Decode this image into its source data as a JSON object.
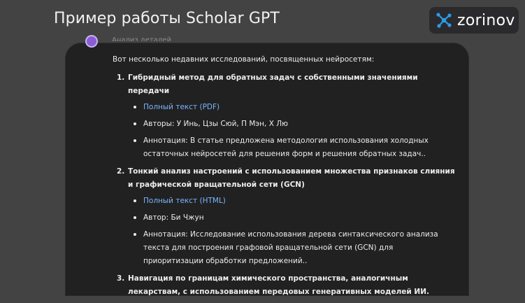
{
  "page": {
    "title": "Пример работы Scholar GPT",
    "brand": "zorinov",
    "brand_color": "#2b9be8"
  },
  "chat": {
    "header_snippet": "Анализ деталей",
    "intro": "Вот несколько недавних исследований, посвященных нейросетям:",
    "papers": [
      {
        "num": "1.",
        "title": "Гибридный метод для обратных задач с собственными значениями передачи",
        "link": "Полный текст (PDF)",
        "authors": "Авторы: У Инь, Цзы Сюй, П Мэн, Х Лю",
        "abstract": "Аннотация: В статье предложена методология использования холодных остаточных нейросетей для решения форм и решения обратных задач.."
      },
      {
        "num": "2.",
        "title": "Тонкий анализ настроений с использованием множества признаков слияния и графической вращательной сети (GCN)",
        "link": "Полный текст (HTML)",
        "authors": "Автор: Би Чжун",
        "abstract": "Аннотация: Исследование использования дерева синтаксического анализа текста для построения графовой вращательной сети (GCN) для приоритизации обработки предложений.."
      },
      {
        "num": "3.",
        "title": "Навигация по границам химического пространства, аналогичным лекарствам, с использованием передовых генеративных моделей ИИ."
      }
    ]
  }
}
